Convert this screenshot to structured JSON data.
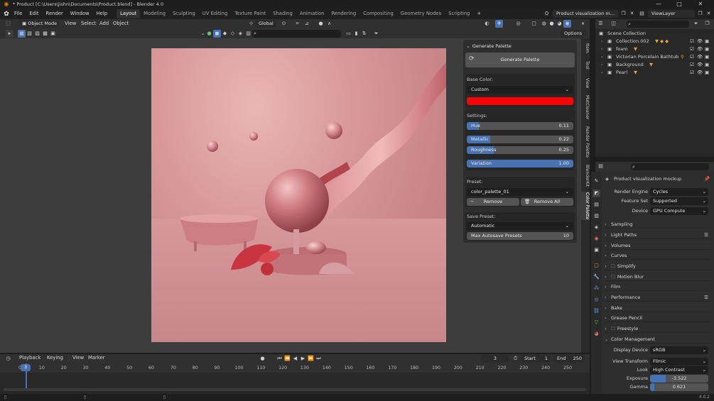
{
  "window": {
    "title": "* Product [C:\\Users\\jishn\\Documents\\Product.blend] - Blender 4.0",
    "minimize": "—",
    "maximize": "□",
    "close": "✕"
  },
  "menubar": {
    "menus": [
      "File",
      "Edit",
      "Render",
      "Window",
      "Help"
    ],
    "workspaces": [
      "Layout",
      "Modeling",
      "Sculpting",
      "UV Editing",
      "Texture Paint",
      "Shading",
      "Animation",
      "Rendering",
      "Compositing",
      "Geometry Nodes",
      "Scripting"
    ],
    "active_workspace": "Layout",
    "add_workspace": "+",
    "scene_name": "Product visualization m...",
    "view_layer": "ViewLayer"
  },
  "viewport_header": {
    "mode": "Object Mode",
    "menus": [
      "View",
      "Select",
      "Add",
      "Object"
    ],
    "orientation": "Global",
    "options": "Options"
  },
  "side_tabs": [
    "Item",
    "Tool",
    "View",
    "MatCleaner",
    "Render Palette",
    "BlenderKit",
    "Color Palette"
  ],
  "palette_panel": {
    "header": "Generate Palette",
    "generate_button": "Generate Palette",
    "base_color_label": "Base Color:",
    "base_color_mode": "Custom",
    "base_color_hex": "#ff0000",
    "settings_label": "Settings:",
    "sliders": [
      {
        "label": "Hue",
        "value": "0.11",
        "fraction": 0.11
      },
      {
        "label": "Metallic",
        "value": "0.22",
        "fraction": 0.22
      },
      {
        "label": "Roughness",
        "value": "0.25",
        "fraction": 0.25
      },
      {
        "label": "Variation",
        "value": "1.00",
        "fraction": 1.0
      }
    ],
    "preset_label": "Preset:",
    "preset_value": "color_palette_01",
    "remove": "Remove",
    "remove_all": "Remove All",
    "save_preset_label": "Save Preset:",
    "save_mode": "Automatic",
    "max_autosave_label": "Max Autosave Presets",
    "max_autosave_value": "10"
  },
  "outliner": {
    "root": "Scene Collection",
    "items": [
      "Collection.002",
      "foam",
      "Victorian Porcelain Bathtub",
      "Background",
      "Pearl"
    ]
  },
  "properties": {
    "scene_name": "Product visualization mockup",
    "render_engine_label": "Render Engine",
    "render_engine": "Cycles",
    "feature_set_label": "Feature Set",
    "feature_set": "Supported",
    "device_label": "Device",
    "device": "GPU Compute",
    "panels": [
      "Sampling",
      "Light Paths",
      "Volumes",
      "Curves",
      "Simplify",
      "Motion Blur",
      "Film",
      "Performance",
      "Bake",
      "Grease Pencil",
      "Freestyle",
      "Color Management"
    ],
    "display_device_label": "Display Device",
    "display_device": "sRGB",
    "view_transform_label": "View Transform",
    "view_transform": "Filmic",
    "look_label": "Look",
    "look": "High Contrast",
    "exposure_label": "Exposure",
    "exposure": "-3.522",
    "gamma_label": "Gamma",
    "gamma": "0.621"
  },
  "timeline": {
    "menus": [
      "Playback",
      "Keying",
      "View",
      "Marker"
    ],
    "current_frame": "3",
    "start_label": "Start",
    "start": "1",
    "end_label": "End",
    "end": "250",
    "ticks": [
      "0",
      "10",
      "20",
      "30",
      "40",
      "50",
      "60",
      "70",
      "80",
      "90",
      "100",
      "110",
      "120",
      "130",
      "140",
      "150",
      "160",
      "170",
      "180",
      "190",
      "200",
      "210",
      "220",
      "230",
      "240",
      "250"
    ]
  },
  "status": {
    "version": "4.0.2"
  }
}
